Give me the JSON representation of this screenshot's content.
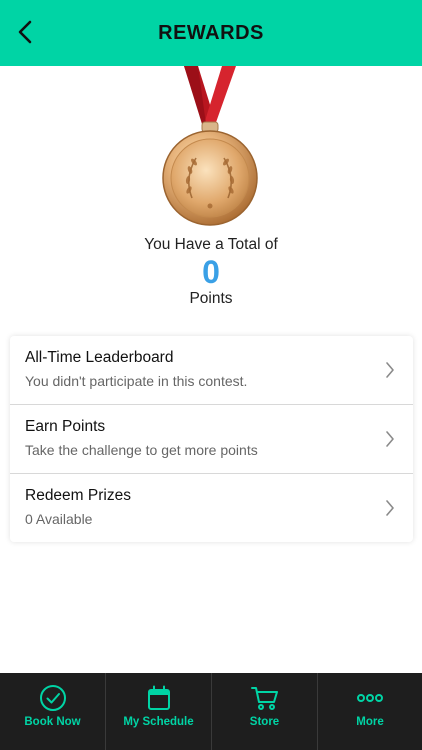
{
  "header": {
    "title": "REWARDS"
  },
  "summary": {
    "total_label": "You Have a Total of",
    "points_value": "0",
    "points_label": "Points"
  },
  "menu": {
    "items": [
      {
        "title": "All-Time Leaderboard",
        "subtitle": "You didn't participate in this contest."
      },
      {
        "title": "Earn Points",
        "subtitle": "Take the challenge to get more points"
      },
      {
        "title": "Redeem Prizes",
        "subtitle": "0 Available"
      }
    ]
  },
  "tabbar": {
    "tabs": [
      {
        "label": "Book Now",
        "icon": "check-circle-icon"
      },
      {
        "label": "My Schedule",
        "icon": "calendar-icon"
      },
      {
        "label": "Store",
        "icon": "cart-icon"
      },
      {
        "label": "More",
        "icon": "more-dots-icon"
      }
    ]
  },
  "colors": {
    "accent": "#00d4a5",
    "points": "#3aa0e6",
    "tabbar_bg": "#1e1e1e",
    "ribbon": "#c81e2a",
    "medal_gold": "#d9a05a"
  }
}
